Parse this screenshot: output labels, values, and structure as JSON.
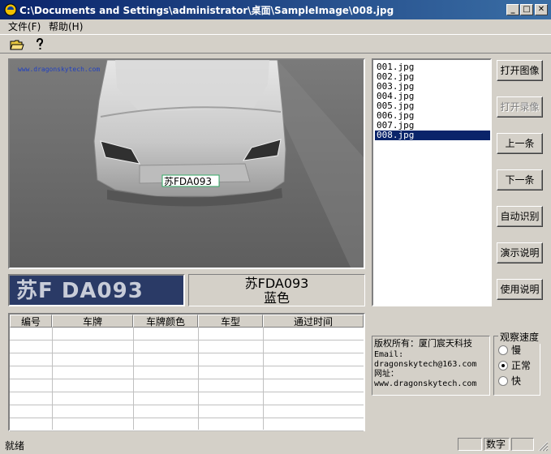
{
  "window": {
    "title": "C:\\Documents and Settings\\administrator\\桌面\\SampleImage\\008.jpg",
    "minimize": "_",
    "maximize": "□",
    "close": "✕"
  },
  "menu": {
    "file": "文件(F)",
    "help": "帮助(H)"
  },
  "toolbar": {
    "open_icon": "open-folder-icon",
    "help_icon": "help-icon"
  },
  "image": {
    "watermark": "www.dragonskytech.com",
    "plate_overlay": "苏FDA093"
  },
  "plate_crop_text": "苏F DA093",
  "result": {
    "plate": "苏FDA093",
    "color": "蓝色"
  },
  "table": {
    "headers": [
      "编号",
      "车牌",
      "车牌颜色",
      "车型",
      "通过时间"
    ],
    "rows": []
  },
  "files": {
    "items": [
      "001.jpg",
      "002.jpg",
      "003.jpg",
      "004.jpg",
      "005.jpg",
      "006.jpg",
      "007.jpg",
      "008.jpg"
    ],
    "selected_index": 7
  },
  "buttons": {
    "open_image": "打开图像",
    "open_video": "打开录像",
    "prev": "上一条",
    "next": "下一条",
    "auto_recognize": "自动识别",
    "demo": "演示说明",
    "usage": "使用说明"
  },
  "copyright": {
    "owner": "版权所有：厦门宸天科技",
    "email_label": "Email:",
    "email": "dragonskytech@163.com",
    "url_label": "网址：",
    "url": "www.dragonskytech.com"
  },
  "speed": {
    "title": "观察速度",
    "slow": "慢",
    "normal": "正常",
    "fast": "快",
    "selected": "正常"
  },
  "status": {
    "text": "就绪",
    "numlock": "数字"
  },
  "colors": {
    "titlebar": "#0a246a",
    "selection": "#0a246a",
    "face": "#d4d0c8"
  }
}
